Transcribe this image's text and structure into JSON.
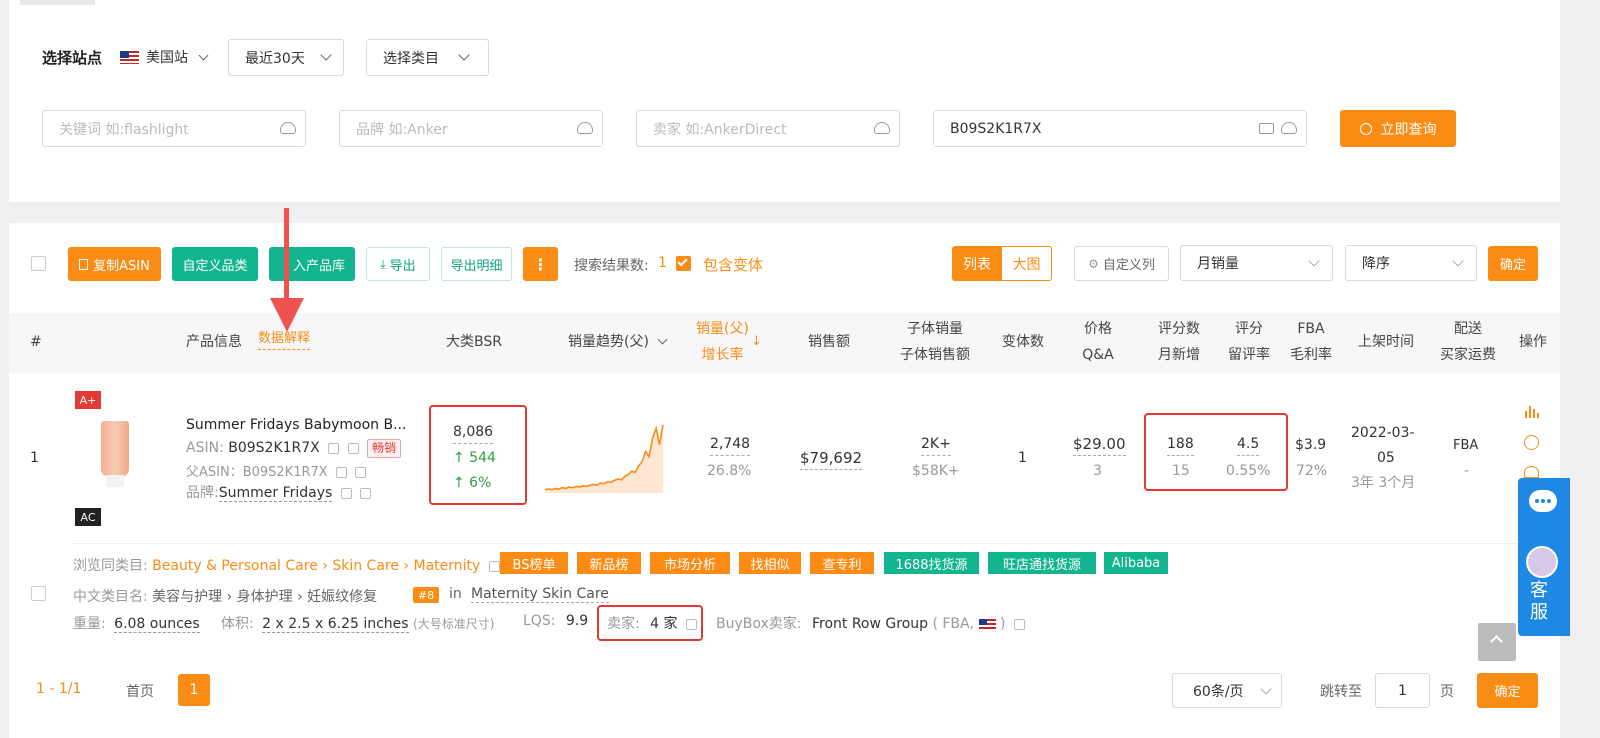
{
  "filters": {
    "site_label": "选择站点",
    "site_value": "美国站",
    "date_value": "最近30天",
    "category_value": "选择类目",
    "keyword_placeholder": "关键词 如:flashlight",
    "brand_placeholder": "品牌 如:Anker",
    "seller_placeholder": "卖家 如:AnkerDirect",
    "asin_value": "B09S2K1R7X",
    "search_button": "立即查询"
  },
  "toolbar": {
    "copy_asin": "复制ASIN",
    "custom_category": "自定义品类",
    "add_to_library": "入产品库",
    "export": "导出",
    "export_detail": "导出明细",
    "more": "⋮",
    "result_count_label": "搜索结果数:",
    "result_count": "1",
    "include_variants": "包含变体",
    "view_list": "列表",
    "view_grid": "大图",
    "custom_columns": "自定义列",
    "sort_field": "月销量",
    "sort_order": "降序",
    "confirm": "确定"
  },
  "table_headers": {
    "index": "#",
    "product_info": "产品信息",
    "data_explain": "数据解释",
    "bsr": "大类BSR",
    "trend": "销量趋势(父)",
    "sales_1": "销量(父)",
    "sales_2": "增长率",
    "revenue": "销售额",
    "child_1": "子体销量",
    "child_2": "子体销售额",
    "variants": "变体数",
    "price_1": "价格",
    "price_2": "Q&A",
    "reviews_1": "评分数",
    "reviews_2": "月新增",
    "rating_1": "评分",
    "rating_2": "留评率",
    "fba_1": "FBA",
    "fba_2": "毛利率",
    "launch": "上架时间",
    "ship_1": "配送",
    "ship_2": "买家运费",
    "actions": "操作"
  },
  "product": {
    "index": "1",
    "badge_aplus": "A+",
    "badge_ac": "AC",
    "title": "Summer Fridays Babymoon B...",
    "asin_label": "ASIN:",
    "asin": "B09S2K1R7X",
    "hot_tag": "畅销",
    "parent_asin_label": "父ASIN：",
    "parent_asin": "B09S2K1R7X",
    "brand_label": "品牌:",
    "brand": "Summer Fridays",
    "bsr": "8,086",
    "bsr_change": "↑ 544",
    "bsr_pct": "↑ 6%",
    "sales": "2,748",
    "growth": "26.8%",
    "revenue": "$79,692",
    "child_sales": "2K+",
    "child_revenue": "$58K+",
    "variants": "1",
    "price": "$29.00",
    "qa": "3",
    "review_count": "188",
    "review_new": "15",
    "rating": "4.5",
    "review_rate": "0.55%",
    "fba": "$3.9",
    "margin": "72%",
    "launch_1": "2022-03-",
    "launch_2": "05",
    "launch_age": "3年 3个月",
    "ship": "FBA",
    "ship_fee": "-",
    "trend_points": [
      2,
      3,
      2,
      4,
      3,
      5,
      4,
      6,
      5,
      7,
      6,
      8,
      7,
      9,
      10,
      9,
      12,
      11,
      14,
      13,
      16,
      18,
      17,
      22,
      25,
      30,
      28,
      38,
      45,
      60,
      52,
      80,
      95,
      70,
      100
    ]
  },
  "details": {
    "browse_label": "浏览同类目:",
    "cat_1": "Beauty & Personal Care",
    "cat_2": "Skin Care",
    "cat_3": "Maternity",
    "tags": [
      "BS榜单",
      "新品榜",
      "市场分析",
      "找相似",
      "查专利",
      "1688找货源",
      "旺店通找货源",
      "Alibaba"
    ],
    "cn_cat_label": "中文类目名:",
    "cn_cat": "美容与护理 › 身体护理 › 妊娠纹修复",
    "rank_badge": "#8",
    "rank_in": "in",
    "rank_cat": "Maternity Skin Care",
    "weight_label": "重量:",
    "weight": "6.08 ounces",
    "volume_label": "体积:",
    "volume": "2 x 2.5 x 6.25 inches",
    "volume_note": "(大号标准尺寸)",
    "lqs_label": "LQS:",
    "lqs": "9.9",
    "seller_label": "卖家:",
    "seller_count": "4 家",
    "buybox_label": "BuyBox卖家:",
    "buybox": "Front Row Group",
    "buybox_paren": "( FBA,",
    "buybox_close": ")"
  },
  "pagination": {
    "range": "1 - 1/1",
    "first": "首页",
    "page": "1",
    "per_page": "60条/页",
    "jump_label": "跳转至",
    "jump_value": "1",
    "page_unit": "页",
    "confirm": "确定"
  },
  "side": {
    "service": "客服"
  },
  "colors": {
    "accent": "#fa8c16",
    "green": "#13b58e",
    "highlight": "#e53935",
    "blue": "#1e88e5"
  }
}
